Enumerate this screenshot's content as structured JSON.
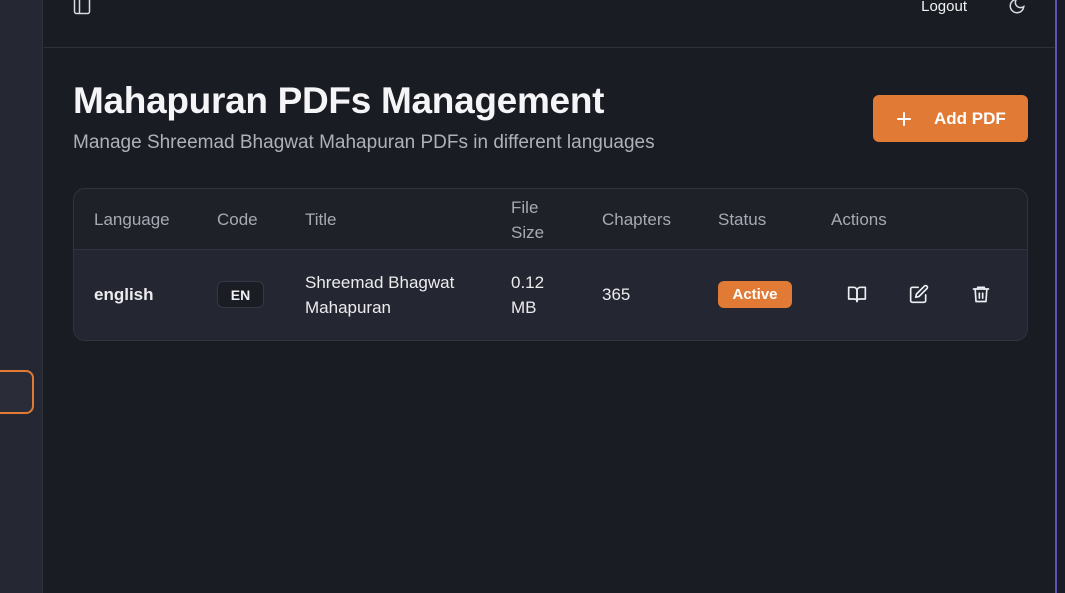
{
  "header": {
    "logout_label": "Logout",
    "icons": [
      "sidebar-toggle-icon",
      "moon-icon"
    ]
  },
  "page": {
    "title": "Mahapuran PDFs Management",
    "subtitle": "Manage Shreemad Bhagwat Mahapuran PDFs in different languages",
    "add_button_label": "Add PDF"
  },
  "table": {
    "columns": [
      "Language",
      "Code",
      "Title",
      "File Size",
      "Chapters",
      "Status",
      "Actions"
    ],
    "column_file_size_line1": "File",
    "column_file_size_line2": "Size",
    "rows": [
      {
        "language": "english",
        "code": "EN",
        "title_line1": "Shreemad Bhagwat",
        "title_line2": "Mahapuran",
        "file_size_line1": "0.12",
        "file_size_line2": "MB",
        "chapters": "365",
        "status": "Active",
        "actions": [
          "book-open-icon",
          "edit-icon",
          "trash-icon"
        ]
      }
    ]
  },
  "colors": {
    "accent": "#e07a35",
    "background": "#1a1c23",
    "sidebar": "#252833"
  }
}
